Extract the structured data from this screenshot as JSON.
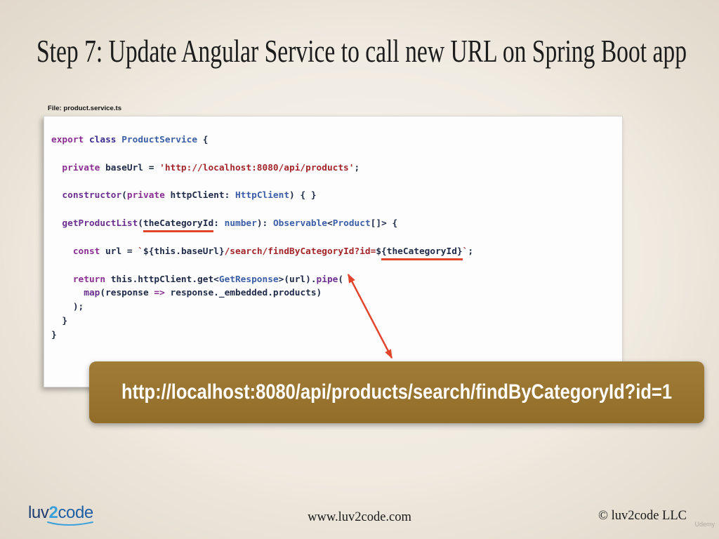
{
  "slide": {
    "title": "Step 7: Update Angular Service to call new URL on Spring Boot app",
    "file_label": "File: product.service.ts",
    "callout_url": "http://localhost:8080/api/products/search/findByCategoryId?id=1"
  },
  "code": {
    "lines": [
      [
        {
          "text": "export",
          "color": "#8a2f91"
        },
        {
          "text": " ",
          "color": "#1f2a48"
        },
        {
          "text": "class",
          "color": "#3a2d8c"
        },
        {
          "text": " ",
          "color": "#1f2a48"
        },
        {
          "text": "ProductService",
          "color": "#3b5ea6"
        },
        {
          "text": " {",
          "color": "#1f2a48"
        }
      ],
      [],
      [
        {
          "text": "  ",
          "color": "#1f2a48"
        },
        {
          "text": "private",
          "color": "#8a2f91"
        },
        {
          "text": " baseUrl = ",
          "color": "#1f2a48"
        },
        {
          "text": "'http://localhost:8080/api/products'",
          "color": "#a3262b"
        },
        {
          "text": ";",
          "color": "#1f2a48"
        }
      ],
      [],
      [
        {
          "text": "  ",
          "color": "#1f2a48"
        },
        {
          "text": "constructor",
          "color": "#6b2f8f"
        },
        {
          "text": "(",
          "color": "#1f2a48"
        },
        {
          "text": "private",
          "color": "#8a2f91"
        },
        {
          "text": " httpClient: ",
          "color": "#1f2a48"
        },
        {
          "text": "HttpClient",
          "color": "#3b5ea6"
        },
        {
          "text": ") { }",
          "color": "#1f2a48"
        }
      ],
      [],
      [
        {
          "text": "  ",
          "color": "#1f2a48"
        },
        {
          "text": "getProductList",
          "color": "#6b2f8f"
        },
        {
          "text": "(",
          "color": "#1f2a48"
        },
        {
          "text": "theCategoryId",
          "color": "#1f2a48",
          "underline": true
        },
        {
          "text": ": ",
          "color": "#1f2a48"
        },
        {
          "text": "number",
          "color": "#3b5ea6"
        },
        {
          "text": "): ",
          "color": "#1f2a48"
        },
        {
          "text": "Observable",
          "color": "#3b5ea6"
        },
        {
          "text": "<",
          "color": "#1f2a48"
        },
        {
          "text": "Product",
          "color": "#3b5ea6"
        },
        {
          "text": "[]> {",
          "color": "#1f2a48"
        }
      ],
      [],
      [
        {
          "text": "    ",
          "color": "#1f2a48"
        },
        {
          "text": "const",
          "color": "#8a2f91"
        },
        {
          "text": " url = ",
          "color": "#1f2a48"
        },
        {
          "text": "`",
          "color": "#a3262b"
        },
        {
          "text": "${this.baseUrl}",
          "color": "#1f2a48"
        },
        {
          "text": "/search/findByCategoryId?id=",
          "color": "#a3262b"
        },
        {
          "text": "$",
          "color": "#1f2a48"
        },
        {
          "text": "{theCategoryId}",
          "color": "#1f2a48",
          "underline": true
        },
        {
          "text": "`",
          "color": "#a3262b"
        },
        {
          "text": ";",
          "color": "#1f2a48"
        }
      ],
      [],
      [
        {
          "text": "    ",
          "color": "#1f2a48"
        },
        {
          "text": "return",
          "color": "#8a2f91"
        },
        {
          "text": " this.httpClient.get<",
          "color": "#1f2a48"
        },
        {
          "text": "GetResponse",
          "color": "#3b5ea6"
        },
        {
          "text": ">(url).",
          "color": "#1f2a48"
        },
        {
          "text": "pipe",
          "color": "#6b2f8f"
        },
        {
          "text": "(",
          "color": "#1f2a48"
        }
      ],
      [
        {
          "text": "      ",
          "color": "#1f2a48"
        },
        {
          "text": "map",
          "color": "#6b2f8f"
        },
        {
          "text": "(response ",
          "color": "#1f2a48"
        },
        {
          "text": "=>",
          "color": "#8a2f91"
        },
        {
          "text": " response._embedded.products)",
          "color": "#1f2a48"
        }
      ],
      [
        {
          "text": "    );",
          "color": "#1f2a48"
        }
      ],
      [
        {
          "text": "  }",
          "color": "#1f2a48"
        }
      ],
      [
        {
          "text": "}",
          "color": "#1f2a48"
        }
      ]
    ]
  },
  "colors": {
    "background": "#efe9de",
    "code_background": "#fdfdfd",
    "callout_background": "#9a742b",
    "highlight": "#e2452b"
  },
  "footer": {
    "logo": {
      "luv": "luv",
      "two": "2",
      "code": "code"
    },
    "logo_colors": {
      "luv": "#1e3d72",
      "two": "#3aa0dc",
      "code": "#1f5fa6"
    },
    "website": "www.luv2code.com",
    "copyright": "© luv2code LLC",
    "watermark": "Udemy"
  }
}
